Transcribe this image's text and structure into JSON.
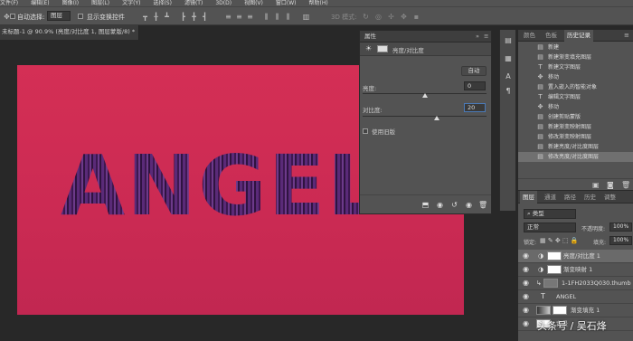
{
  "menubar": {
    "items": [
      "文件(F)",
      "编辑(E)",
      "图像(I)",
      "图层(L)",
      "文字(Y)",
      "选择(S)",
      "滤镜(T)",
      "3D(D)",
      "视图(V)",
      "窗口(W)",
      "帮助(H)"
    ]
  },
  "options": {
    "auto_select_label": "自动选择:",
    "auto_select_value": "图层",
    "show_transform_label": "显示变换控件",
    "mode_3d_label": "3D 模式:"
  },
  "document": {
    "tab_title": "未标题-1 @ 90.9% (亮度/对比度 1, 图层蒙版/8) *",
    "close": "×"
  },
  "canvas": {
    "text": "ANGEL"
  },
  "properties": {
    "title": "属性",
    "subtitle": "亮度/对比度",
    "auto_button": "自动",
    "brightness_label": "亮度:",
    "brightness_value": "0",
    "contrast_label": "对比度:",
    "contrast_value": "20",
    "legacy_label": "使用旧版",
    "brightness_pos": 0.5,
    "contrast_pos": 0.6
  },
  "history": {
    "tabs": [
      "颜色",
      "色板",
      "历史记录"
    ],
    "items": [
      {
        "icon": "doc-icon",
        "text": "新建"
      },
      {
        "icon": "doc-icon",
        "text": "新建渐变填充图层"
      },
      {
        "icon": "type-icon",
        "text": "新建文字图层"
      },
      {
        "icon": "move-icon",
        "text": "移动"
      },
      {
        "icon": "doc-icon",
        "text": "置入嵌入的智能对象"
      },
      {
        "icon": "type-icon",
        "text": "编辑文字图层"
      },
      {
        "icon": "move-icon",
        "text": "移动"
      },
      {
        "icon": "doc-icon",
        "text": "创建剪贴蒙版"
      },
      {
        "icon": "doc-icon",
        "text": "新建渐变映射图层"
      },
      {
        "icon": "doc-icon",
        "text": "修改渐变映射图层"
      },
      {
        "icon": "doc-icon",
        "text": "新建亮度/对比度图层"
      },
      {
        "icon": "doc-icon",
        "text": "修改亮度/对比度图层"
      }
    ]
  },
  "layers": {
    "tabs": [
      "图层",
      "通道",
      "路径",
      "历史",
      "调整"
    ],
    "kind_label": "类型",
    "blend_mode": "正常",
    "opacity_label": "不透明度:",
    "opacity_value": "100%",
    "lock_label": "锁定:",
    "fill_label": "填充:",
    "fill_value": "100%",
    "rows": [
      {
        "name": "亮度/对比度 1",
        "selected": true
      },
      {
        "name": "渐变映射 1",
        "selected": false
      },
      {
        "name": "1-1FH2033Q030.thumb",
        "selected": false
      },
      {
        "name": "ANGEL",
        "selected": false
      },
      {
        "name": "渐变填充 1",
        "selected": false
      },
      {
        "name": "背景",
        "selected": false
      }
    ]
  },
  "watermark": "头条号 / 吴石烽",
  "colors": {
    "canvas": "#d42f55",
    "text": "#4a2063",
    "panel": "#535353"
  }
}
